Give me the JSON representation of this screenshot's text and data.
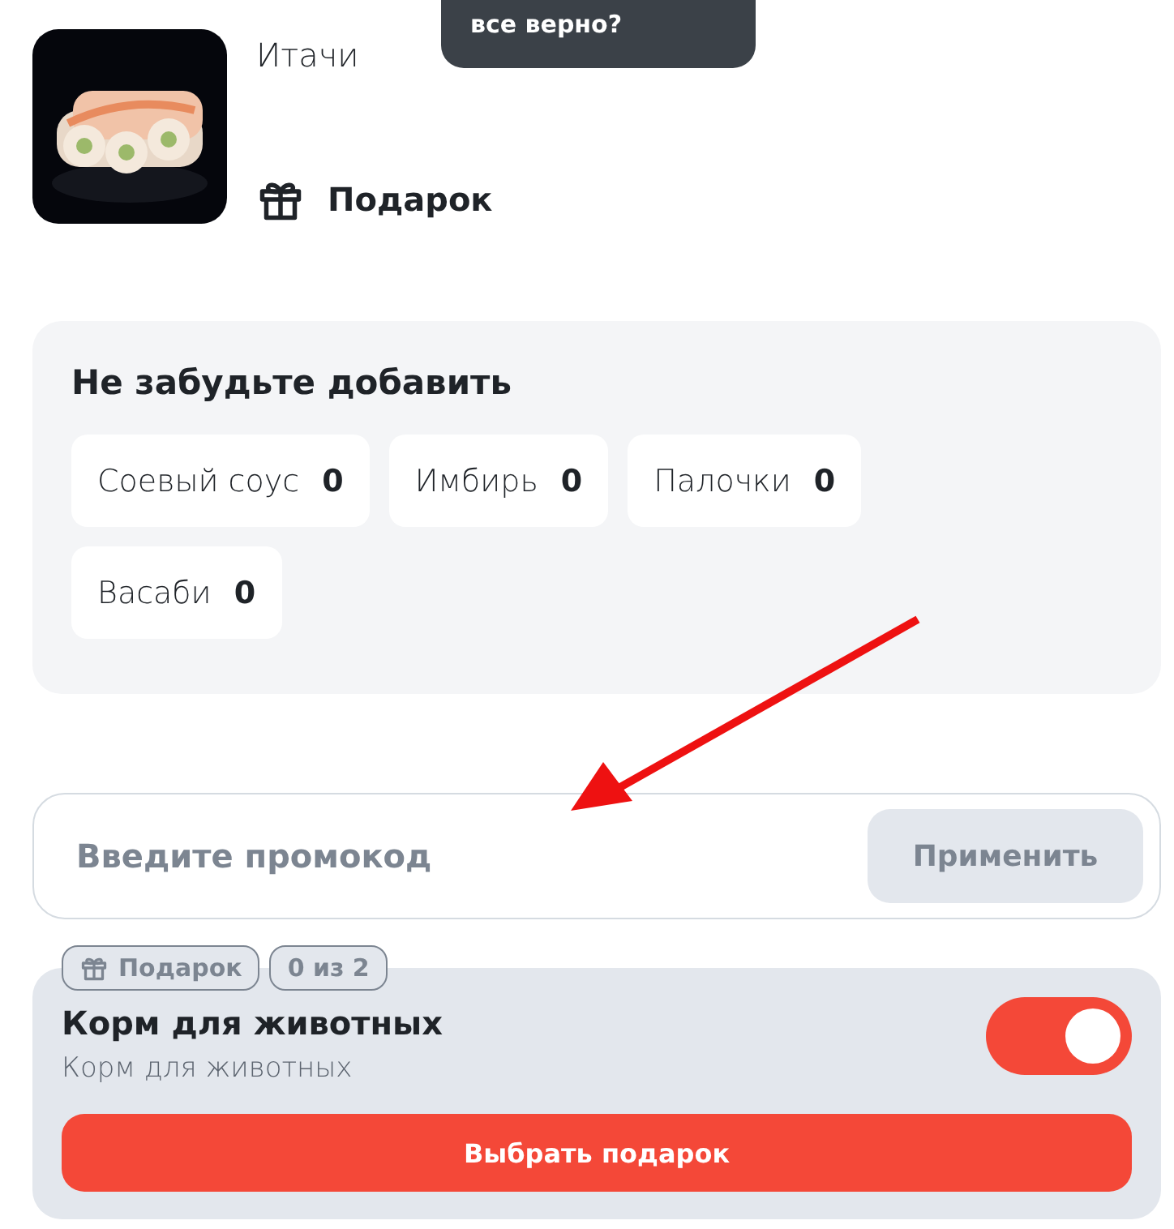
{
  "product": {
    "name": "Итачи",
    "gift_label": "Подарок"
  },
  "tooltip": {
    "text": "все верно?"
  },
  "addons": {
    "title": "Не забудьте добавить",
    "items": [
      {
        "name": "Соевый соус",
        "count": "0"
      },
      {
        "name": "Имбирь",
        "count": "0"
      },
      {
        "name": "Палочки",
        "count": "0"
      },
      {
        "name": "Васаби",
        "count": "0"
      }
    ]
  },
  "promo": {
    "placeholder": "Введите промокод",
    "button": "Применить"
  },
  "gift": {
    "badges": [
      {
        "kind": "gift",
        "label": "Подарок"
      },
      {
        "kind": "count",
        "label": "0 из 2"
      }
    ],
    "title": "Корм для животных",
    "subtitle": "Корм для животных",
    "on": true,
    "button": "Выбрать подарок"
  }
}
